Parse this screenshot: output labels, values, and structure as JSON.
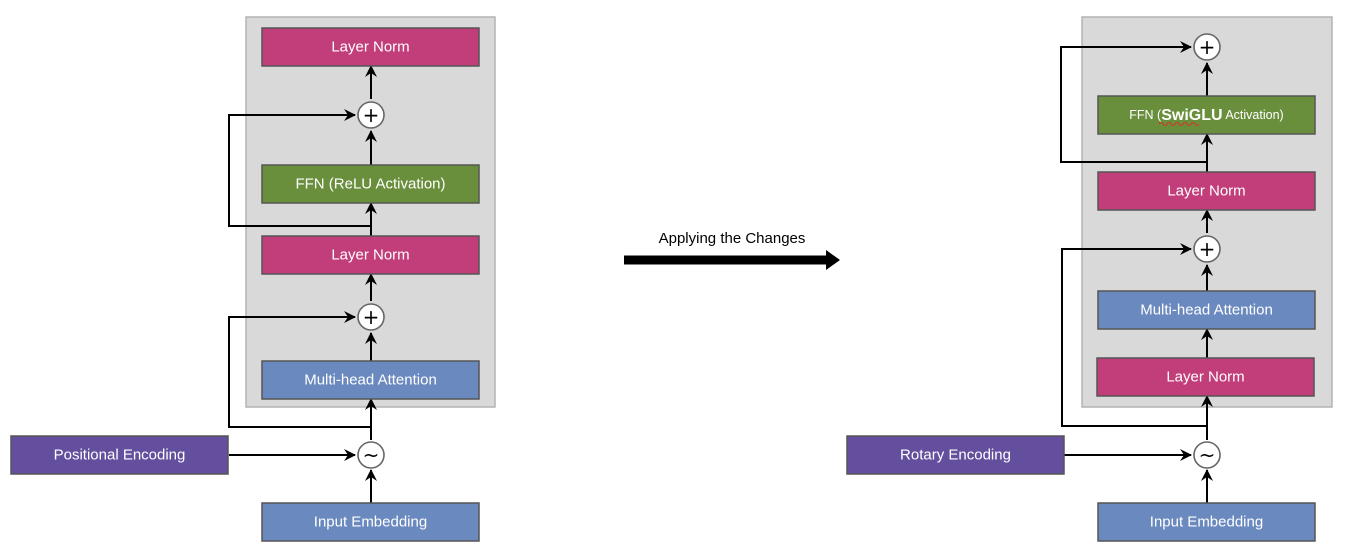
{
  "colors": {
    "layer_norm": "#c13e7a",
    "ffn": "#6a8f3c",
    "attention": "#6a89bf",
    "encoding": "#634f9e",
    "block_bg": "#d9d9d9",
    "block_border": "#b3b3b3",
    "box_border": "#555555"
  },
  "transition": {
    "label": "Applying the Changes"
  },
  "left": {
    "layer_norm_top": "Layer Norm",
    "ffn": "FFN (ReLU Activation)",
    "layer_norm_mid": "Layer Norm",
    "attention": "Multi-head Attention",
    "positional_encoding": "Positional Encoding",
    "input_embedding": "Input Embedding",
    "add_symbol": "+",
    "combine_symbol": "~"
  },
  "right": {
    "ffn_prefix": "FFN (",
    "ffn_highlight": "SwiGLU",
    "ffn_suffix": " Activation)",
    "layer_norm_upper": "Layer Norm",
    "attention": "Multi-head Attention",
    "layer_norm_lower": "Layer Norm",
    "rotary_encoding": "Rotary Encoding",
    "input_embedding": "Input Embedding",
    "add_symbol": "+",
    "combine_symbol": "~"
  }
}
